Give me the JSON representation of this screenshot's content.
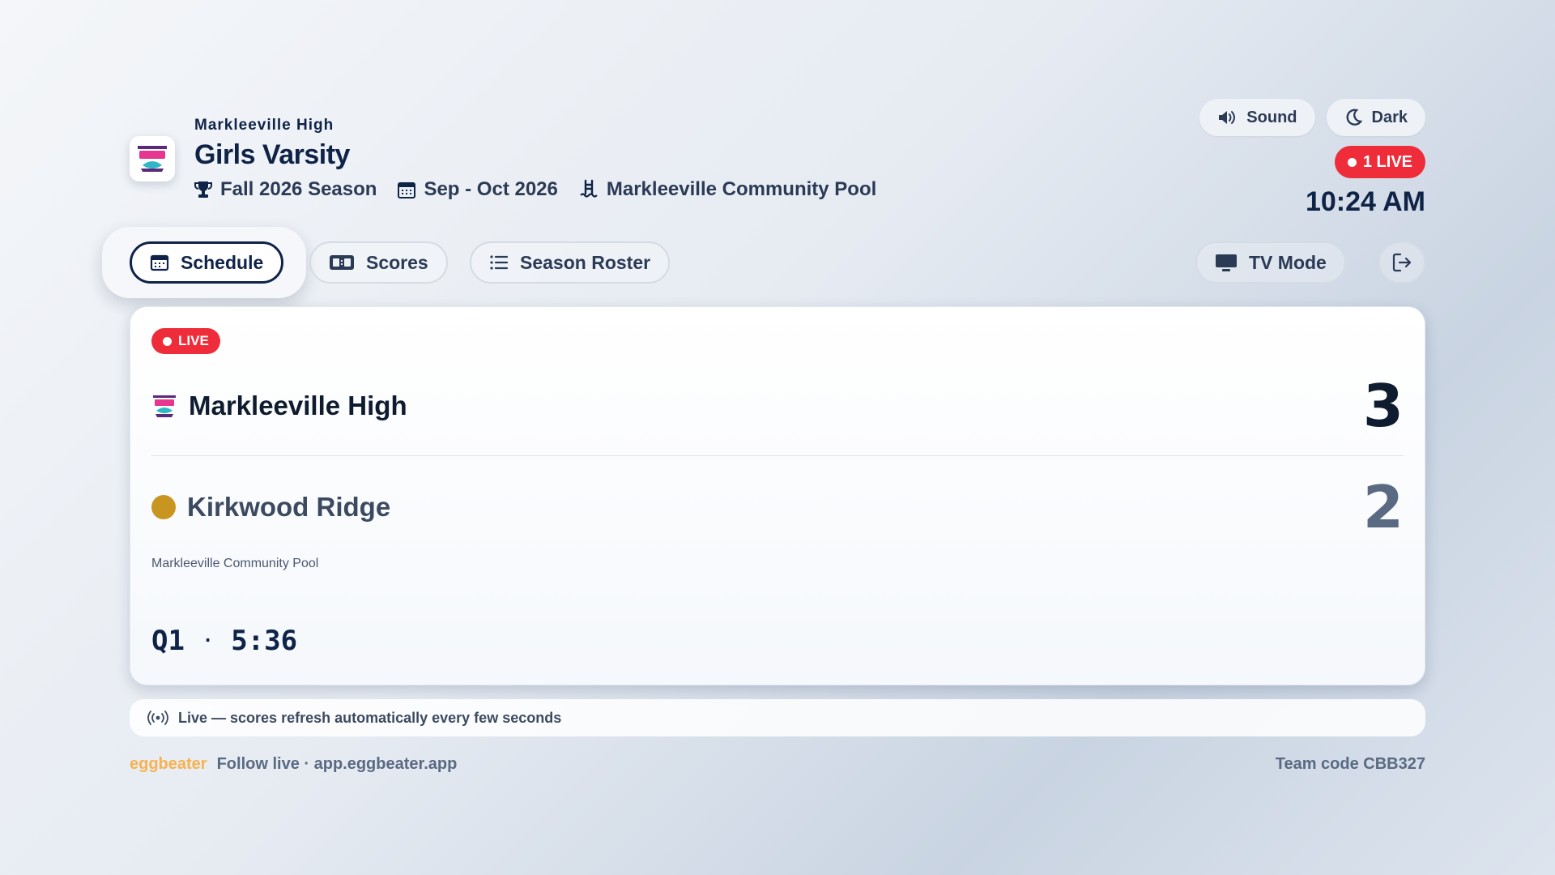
{
  "header": {
    "school": "Markleeville High",
    "team": "Girls Varsity",
    "season": "Fall 2026 Season",
    "dates": "Sep - Oct 2026",
    "venue": "Markleeville Community Pool"
  },
  "controls": {
    "sound_label": "Sound",
    "dark_label": "Dark",
    "live_count_label": "1 LIVE",
    "clock": "10:24 AM"
  },
  "tabs": [
    {
      "label": "Schedule",
      "active": true
    },
    {
      "label": "Scores",
      "active": false
    },
    {
      "label": "Season Roster",
      "active": false
    }
  ],
  "tv_mode_label": "TV Mode",
  "game": {
    "live_label": "LIVE",
    "home": {
      "name": "Markleeville High",
      "score": "3"
    },
    "away": {
      "name": "Kirkwood Ridge",
      "score": "2",
      "color": "#c99521"
    },
    "venue": "Markleeville Community Pool",
    "period": "Q1",
    "separator": "·",
    "clock": "5:36"
  },
  "status_text": "Live — scores refresh automatically every few seconds",
  "footer": {
    "brand": "eggbeater",
    "follow": "Follow live · app.eggbeater.app",
    "team_code": "Team code CBB327"
  },
  "colors": {
    "accent": "#0f2347",
    "live": "#ef2d3a",
    "brand": "#f7b24f"
  }
}
